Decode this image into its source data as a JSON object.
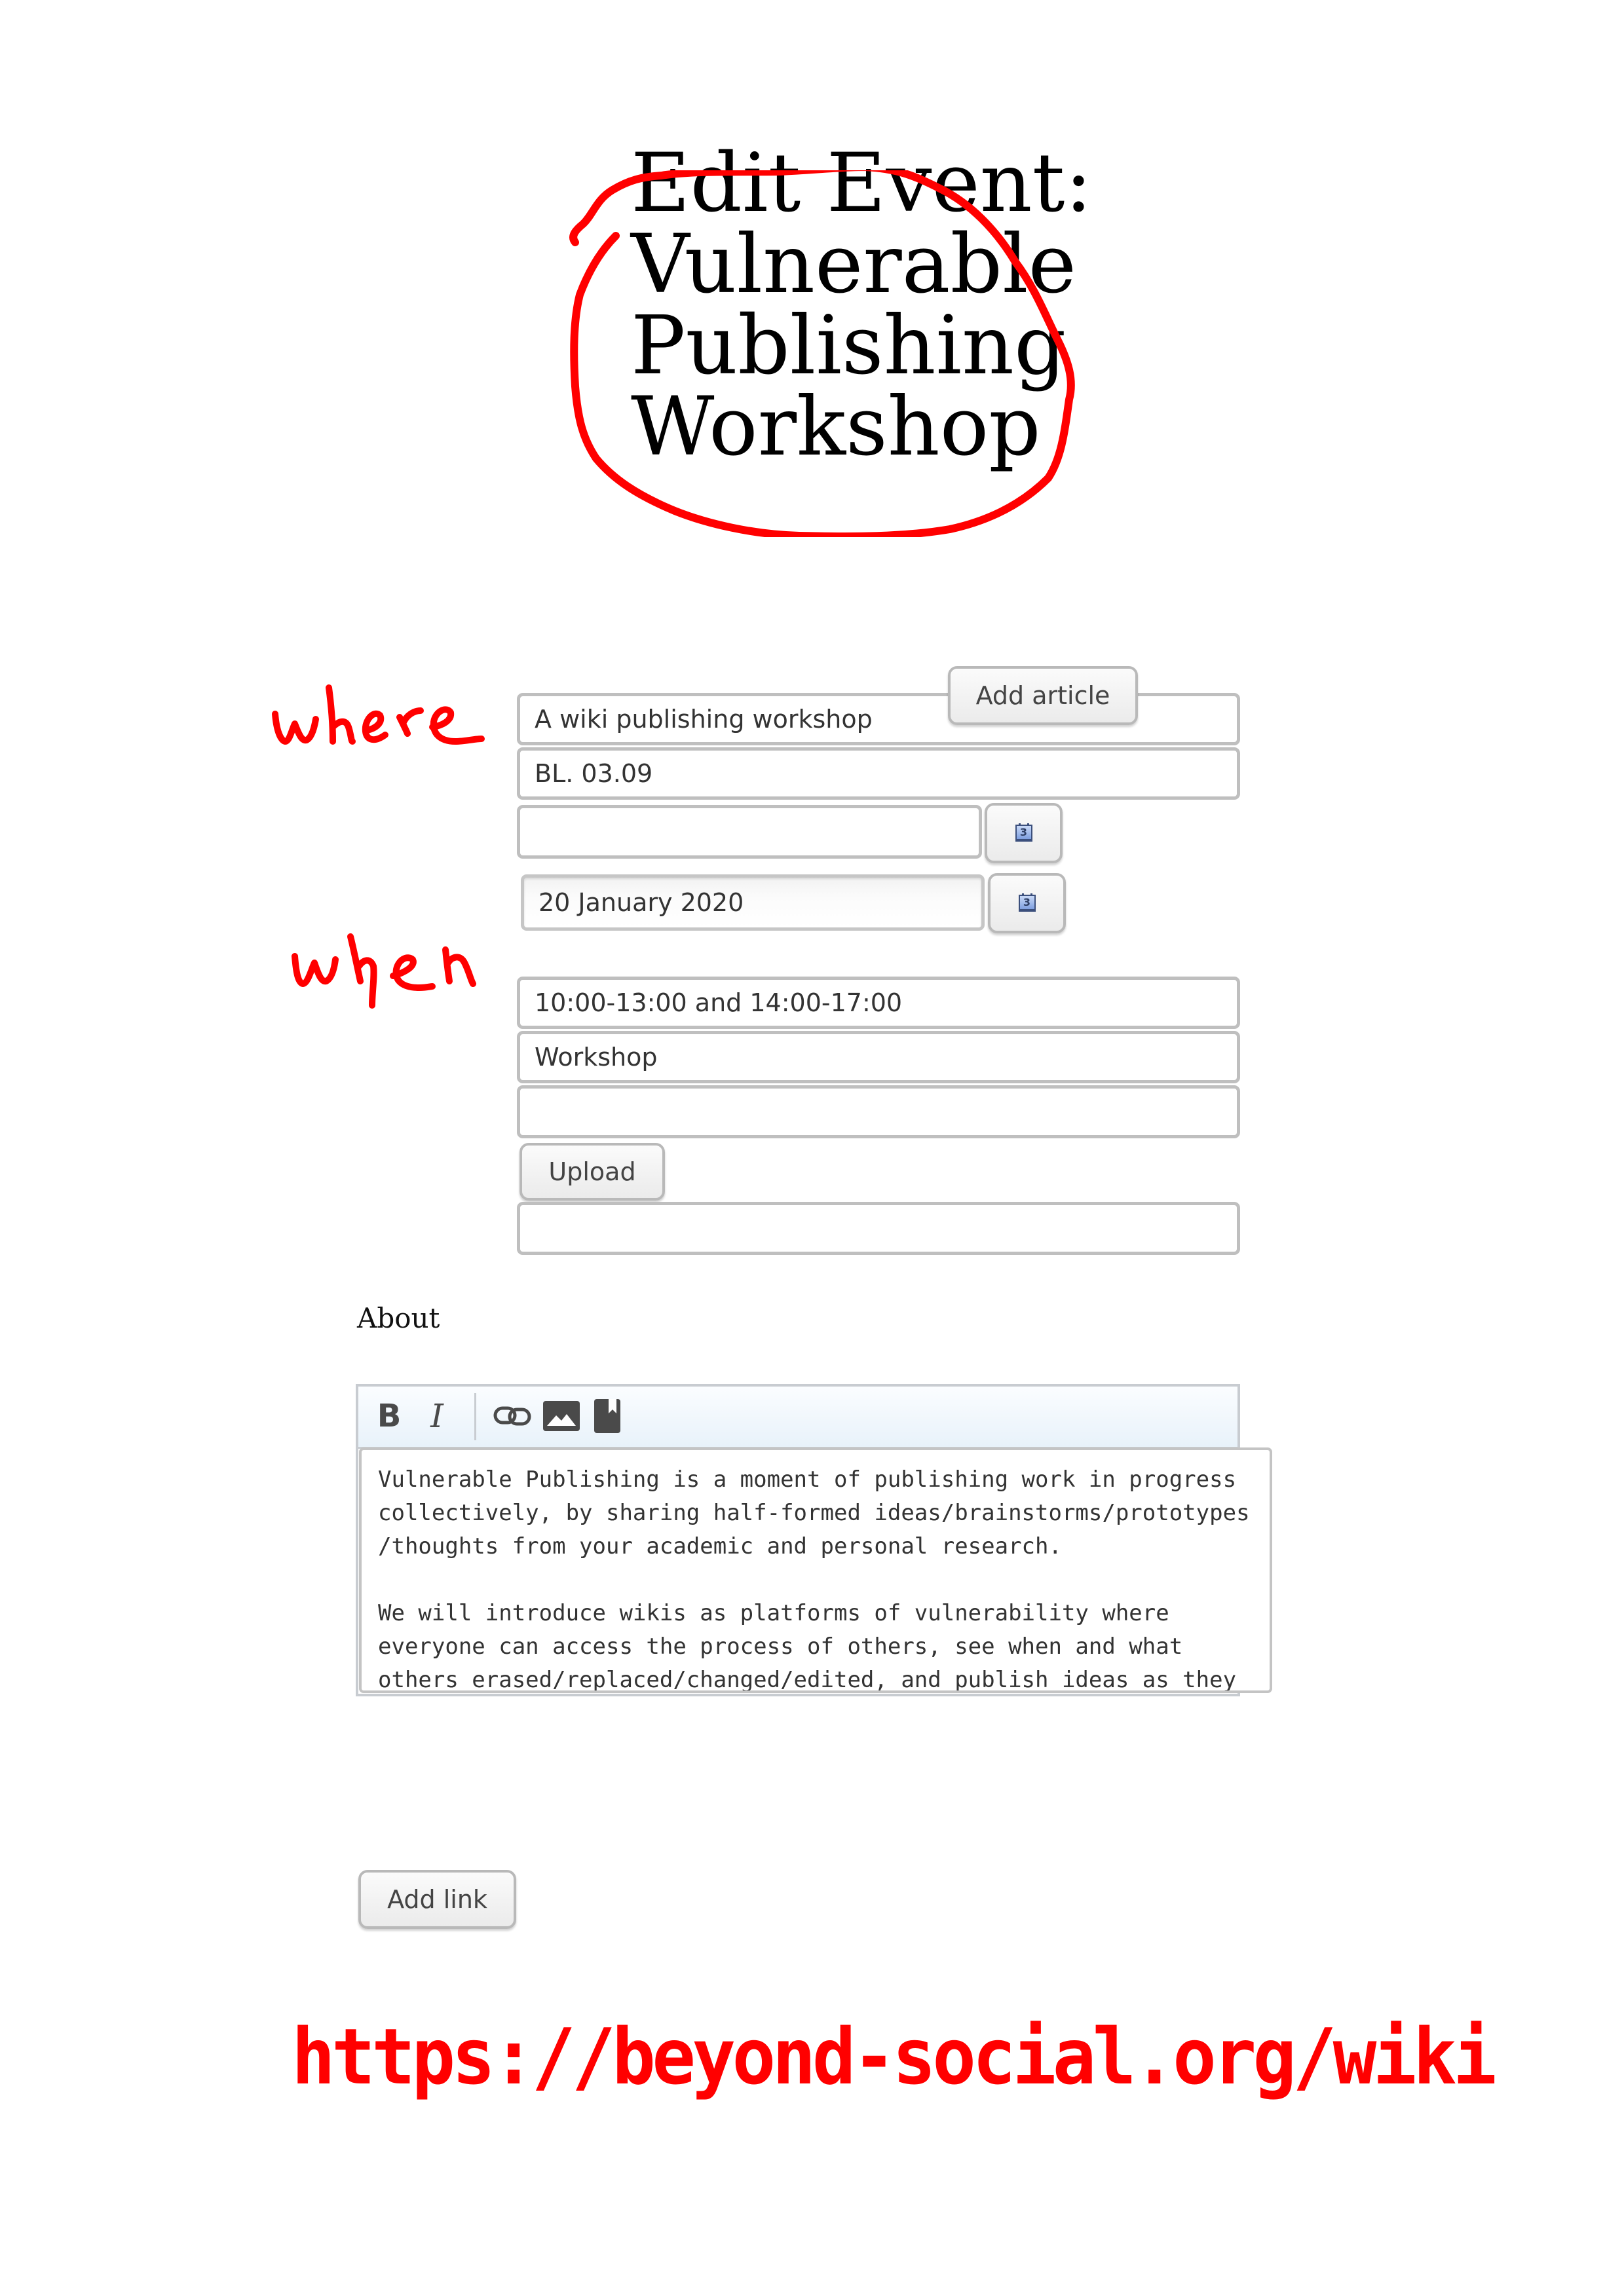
{
  "page": {
    "title_lines": [
      "Edit Event:",
      "Vulnerable",
      "Publishing",
      "Workshop"
    ]
  },
  "form": {
    "summary_value": "A wiki publishing workshop",
    "add_article_label": "Add article",
    "location_value": "BL. 03.09",
    "start_date_value": "",
    "end_date_value": "20 January 2020",
    "calendar_icon_glyph": "3",
    "time_value": "10:00-13:00 and 14:00-17:00",
    "type_value": "Workshop",
    "image_value": "",
    "upload_label": "Upload",
    "extra_value": ""
  },
  "about": {
    "label": "About",
    "toolbar": {
      "bold_label": "B",
      "italic_label": "I",
      "icons": [
        "link-icon",
        "image-icon",
        "bookmark-icon"
      ]
    },
    "text": "Vulnerable Publishing is a moment of publishing work in progress\ncollectively, by sharing half-formed ideas/brainstorms/prototypes\n/thoughts from your academic and personal research.\n\nWe will introduce wikis as platforms of vulnerability where\neveryone can access the process of others, see when and what\nothers erased/replaced/changed/edited, and publish ideas as they\nhappen, rather than finished projects. Wiki is fun! We invite you\nto make mistakes, to edit and curate pages together, or intervene\nin others' pages within the Beyond Social wiki."
  },
  "add_link_label": "Add link",
  "annotations": {
    "color": "#ff0000",
    "where": "where",
    "when": "when",
    "url": "https://beyond-social.org/wiki"
  }
}
